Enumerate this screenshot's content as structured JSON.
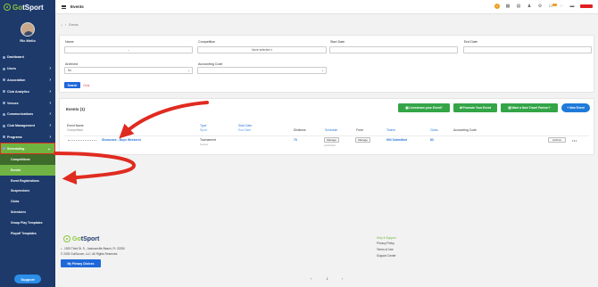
{
  "sidebar": {
    "logo": {
      "go": "Go",
      "sport": "tSport"
    },
    "user_name": "Ric Mello",
    "items": [
      {
        "label": "Dashboard"
      },
      {
        "label": "Users"
      },
      {
        "label": "Association"
      },
      {
        "label": "Club Analytics"
      },
      {
        "label": "Venues"
      },
      {
        "label": "Communications"
      },
      {
        "label": "Club Management"
      },
      {
        "label": "Programs"
      },
      {
        "label": "Scheduling"
      }
    ],
    "sub_items": [
      {
        "label": "Competitions"
      },
      {
        "label": "Events"
      },
      {
        "label": "Event Registrations"
      },
      {
        "label": "Suspensions"
      },
      {
        "label": "Clubs"
      },
      {
        "label": "Schedules"
      },
      {
        "label": "Group Play Templates"
      },
      {
        "label": "Playoff Templates"
      }
    ],
    "support_label": "Support"
  },
  "topbar": {
    "title": "Events",
    "notification_count": "10"
  },
  "breadcrumb": {
    "home": "⌂",
    "separator": "›",
    "current": "Events"
  },
  "filters": {
    "name_label": "Name",
    "name_value": "--",
    "competition_label": "Competition",
    "competition_value": "None selected ▾",
    "start_date_label": "Start Date",
    "end_date_label": "End Date",
    "archived_label": "Archived",
    "archived_value": "No",
    "accounting_code_label": "Accounting Code",
    "search_label": "Search",
    "clear_label": "Clear"
  },
  "events": {
    "heading": "Events (1)",
    "buttons": {
      "livestream": "▣ Livestream your Event?",
      "promote": "⇄ Promote Your Event",
      "travel": "▤ Want a New Travel Partner?",
      "new_event": "+ New Event"
    },
    "columns": {
      "event_name": "Event Name",
      "competition": "Competition",
      "type": "Type",
      "sport": "Sport",
      "start_date": "Start Date",
      "end_date": "End Date",
      "divisions": "Divisions",
      "schedule": "Schedule",
      "form": "Form",
      "teams": "Teams",
      "clubs": "Clubs",
      "accounting_code": "Accounting Code"
    },
    "rows": [
      {
        "event_name": "Showcase - Boys Weekend",
        "type": "Tournament",
        "sport": "Soccer",
        "divisions": "73",
        "schedule_button": "Manage",
        "schedule_status": "published",
        "form_button": "Manage",
        "teams": "694 Submitted",
        "clubs": "83",
        "archive_button": "Archive",
        "more": "•••"
      }
    ]
  },
  "footer": {
    "logo": {
      "go": "Go",
      "sport": "tSport"
    },
    "address": "1529 Third St. S., Jacksonville Beach, FL 32250",
    "copyright": "© 2025 GotSoccer, LLC. All Rights Reserved.",
    "privacy_button": "My Privacy Choices",
    "links": [
      "Help & Support",
      "Privacy Policy",
      "Terms of Use",
      "Support Center"
    ]
  },
  "pagination": {
    "prev": "‹",
    "page": "1",
    "next": "›"
  },
  "colors": {
    "sidebar": "#1d3a6b",
    "accent_green": "#6fb43f",
    "primary_blue": "#1f68d9",
    "annotation_red": "#e02b20"
  }
}
